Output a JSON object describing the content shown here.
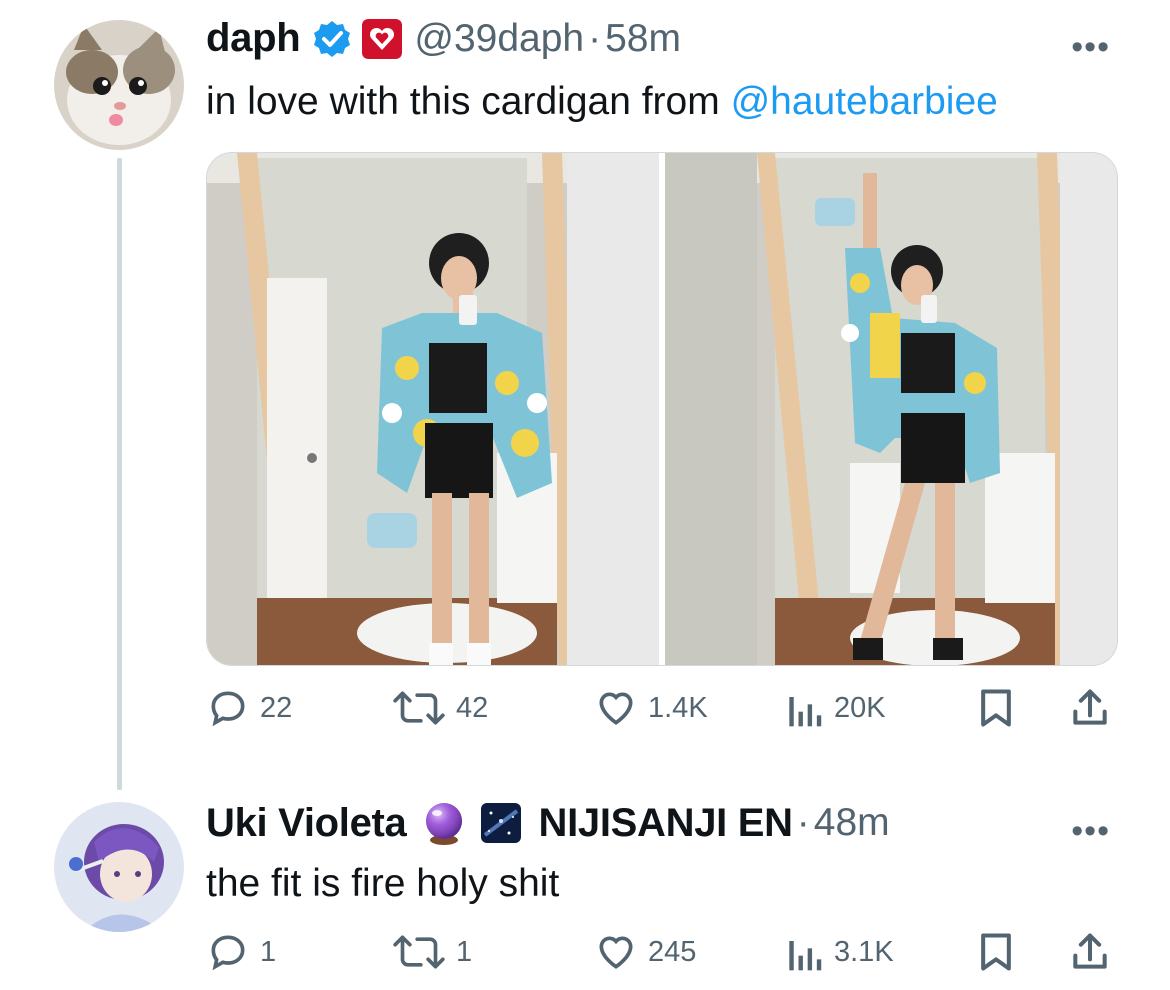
{
  "colors": {
    "accent": "#1d9bf0",
    "muted": "#536471",
    "text": "#0f1419",
    "thread_line": "#cfd9de"
  },
  "tweets": [
    {
      "name": "daph",
      "handle": "@39daph",
      "time": "58m",
      "text_prefix": "in love with this cardigan from ",
      "mention": "@hautebarbiee",
      "badges": [
        "verified-badge-icon",
        "affiliate-heart-badge-icon"
      ],
      "media": [
        "mirror-selfie-photo-1",
        "mirror-selfie-photo-2"
      ],
      "stats": {
        "replies": "22",
        "retweets": "42",
        "likes": "1.4K",
        "views": "20K"
      }
    },
    {
      "name": "Uki Violeta",
      "affiliate": "NIJISANJI EN",
      "time": "48m",
      "text": "the fit is fire holy shit",
      "badges": [
        "crystal-ball-emoji-icon",
        "galaxy-badge-icon"
      ],
      "stats": {
        "replies": "1",
        "retweets": "1",
        "likes": "245",
        "views": "3.1K"
      }
    }
  ],
  "more_label": "•••",
  "separator": "·"
}
